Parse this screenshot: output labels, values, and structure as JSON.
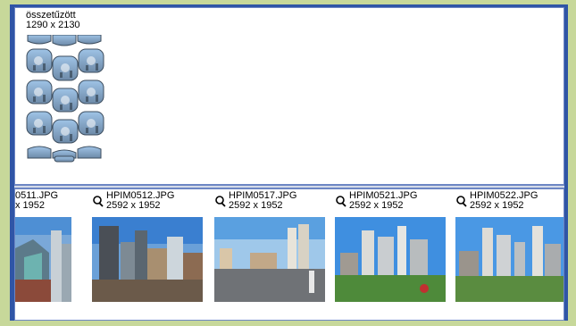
{
  "composite": {
    "name": "összetűzött",
    "dimensions": "1290 x 2130"
  },
  "thumbnails": [
    {
      "name": "0511.JPG",
      "dims": "x 1952",
      "has_icon": false
    },
    {
      "name": "HPIM0512.JPG",
      "dims": "2592 x 1952",
      "has_icon": true
    },
    {
      "name": "HPIM0517.JPG",
      "dims": "2592 x 1952",
      "has_icon": true
    },
    {
      "name": "HPIM0521.JPG",
      "dims": "2592 x 1952",
      "has_icon": true
    },
    {
      "name": "HPIM0522.JPG",
      "dims": "2592 x 1952",
      "has_icon": true
    }
  ],
  "icons": {
    "thumb_icon": "link-icon"
  },
  "colors": {
    "outer_background": "#c7d89a",
    "frame": "#2f55a6",
    "panel": "#ffffff"
  }
}
